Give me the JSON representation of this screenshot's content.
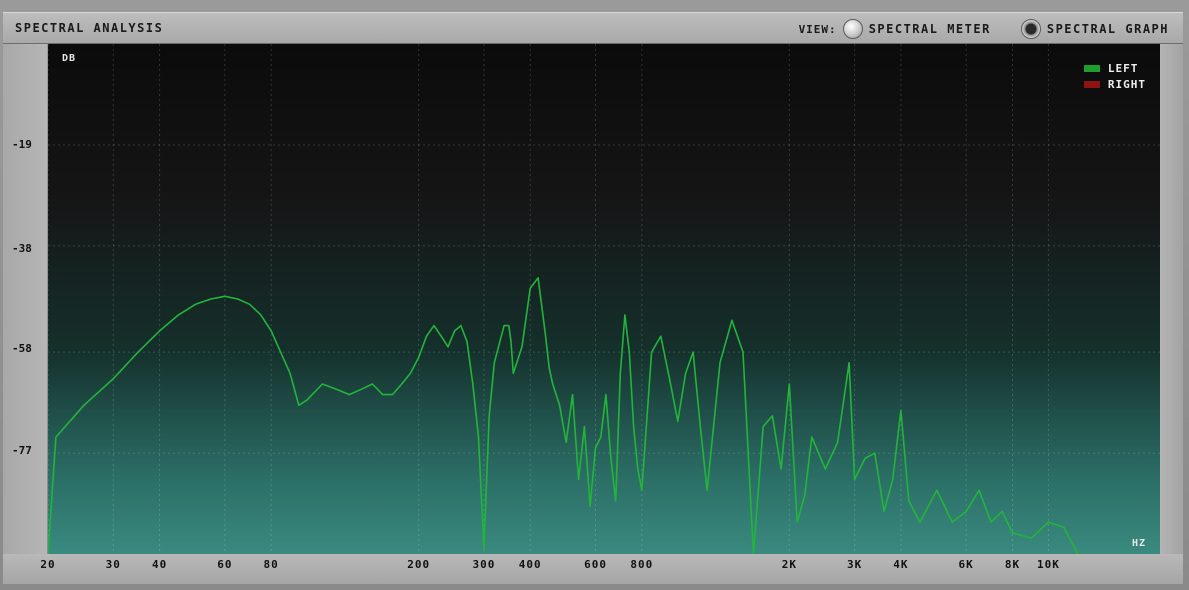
{
  "window": {
    "title": "SPECTRAL ANALYSIS"
  },
  "view": {
    "label": "VIEW:",
    "options": [
      {
        "label": "SPECTRAL METER",
        "selected": false
      },
      {
        "label": "SPECTRAL GRAPH",
        "selected": true
      }
    ]
  },
  "colors": {
    "left": "#1e9e2c",
    "right": "#8e1414",
    "line": "#22b53a"
  },
  "chart_data": {
    "type": "line",
    "y_unit": "DB",
    "x_unit": "HZ",
    "xscale": "log",
    "xlim": [
      20,
      20000
    ],
    "ylim": [
      -96,
      0
    ],
    "yticks": [
      "-19",
      "-38",
      "-58",
      "-77"
    ],
    "xticks": [
      "20",
      "30",
      "40",
      "60",
      "80",
      "200",
      "300",
      "400",
      "600",
      "800",
      "2K",
      "3K",
      "4K",
      "6K",
      "8K",
      "10K"
    ],
    "legend": [
      "LEFT",
      "RIGHT"
    ],
    "legend_position": "top-right",
    "series": [
      {
        "name": "LEFT",
        "x": [
          20,
          21,
          25,
          30,
          35,
          40,
          45,
          50,
          55,
          60,
          65,
          70,
          75,
          80,
          90,
          95,
          100,
          110,
          120,
          130,
          140,
          150,
          160,
          170,
          180,
          190,
          200,
          210,
          220,
          230,
          240,
          250,
          260,
          270,
          280,
          290,
          300,
          310,
          320,
          340,
          350,
          355,
          360,
          380,
          400,
          420,
          440,
          450,
          460,
          480,
          500,
          520,
          540,
          560,
          580,
          600,
          620,
          640,
          660,
          680,
          700,
          720,
          740,
          760,
          780,
          800,
          850,
          900,
          950,
          1000,
          1050,
          1100,
          1150,
          1200,
          1300,
          1400,
          1500,
          1600,
          1700,
          1800,
          1900,
          2000,
          2100,
          2200,
          2300,
          2500,
          2700,
          2900,
          3000,
          3200,
          3400,
          3600,
          3800,
          4000,
          4200,
          4500,
          5000,
          5500,
          6000,
          6500,
          7000,
          7500,
          8000,
          9000,
          10000,
          11000,
          12000
        ],
        "values": [
          -96,
          -74,
          -68,
          -63,
          -58,
          -54,
          -51,
          -49,
          -48,
          -47.5,
          -48,
          -49,
          -51,
          -54,
          -62,
          -68,
          -67,
          -64,
          -65,
          -66,
          -65,
          -64,
          -66,
          -66,
          -64,
          -62,
          -59,
          -55,
          -53,
          -55,
          -57,
          -54,
          -53,
          -56,
          -64,
          -74,
          -95,
          -70,
          -60,
          -53,
          -53,
          -56,
          -62,
          -57,
          -46,
          -44,
          -55,
          -61,
          -64,
          -68,
          -75,
          -66,
          -82,
          -72,
          -87,
          -76,
          -74,
          -66,
          -78,
          -86,
          -62,
          -51,
          -58,
          -72,
          -80,
          -84,
          -58,
          -55,
          -63,
          -71,
          -62,
          -58,
          -72,
          -84,
          -60,
          -52,
          -58,
          -96,
          -72,
          -70,
          -80,
          -64,
          -90,
          -85,
          -74,
          -80,
          -75,
          -60,
          -82,
          -78,
          -77,
          -88,
          -82,
          -69,
          -86,
          -90,
          -84,
          -90,
          -88,
          -84,
          -90,
          -88,
          -92,
          -93,
          -90,
          -91,
          -96
        ]
      },
      {
        "name": "RIGHT",
        "x": [],
        "values": []
      }
    ]
  }
}
